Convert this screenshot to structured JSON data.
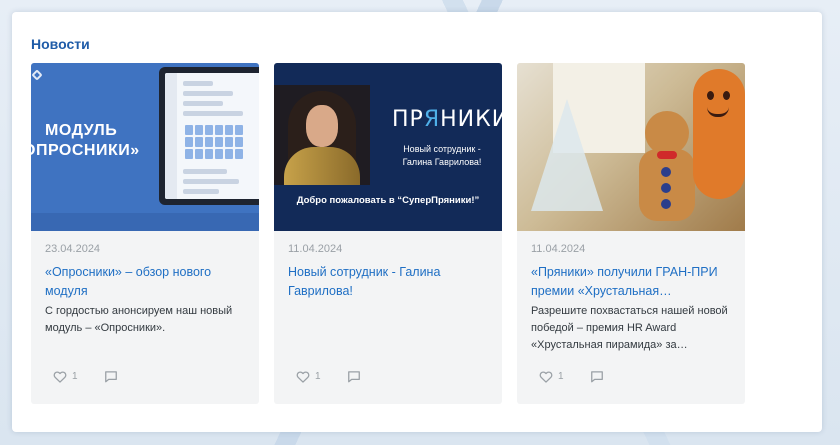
{
  "section": {
    "title": "Новости"
  },
  "cards": [
    {
      "date": "23.04.2024",
      "title": "«Опросники» – обзор нового модуля",
      "excerpt": "С гордостью анонсируем наш новый модуль – «Опросники».",
      "likes": "1",
      "image": {
        "line1": "МОДУЛЬ",
        "line2": "ОПРОСНИКИ»"
      }
    },
    {
      "date": "11.04.2024",
      "title": "Новый сотрудник - Галина Гаврилова!",
      "excerpt": "",
      "likes": "1",
      "image": {
        "brand_pre": "ПР",
        "brand_accent": "Я",
        "brand_post": "НИКИ",
        "subtitle": "Новый сотрудник - Галина Гаврилова!",
        "welcome": "Добро пожаловать в “СуперПряники!”"
      }
    },
    {
      "date": "11.04.2024",
      "title": "«Пряники» получили ГРАН-ПРИ премии «Хрустальная…",
      "excerpt": "Разрешите похвастаться нашей новой победой – премия HR Award «Хрустальная пирамида» за…",
      "likes": "1",
      "image": {}
    }
  ],
  "icons": {
    "like": "heart-outline-icon",
    "comment": "comment-icon"
  },
  "colors": {
    "accent": "#1f6fc4",
    "title": "#1f5ca8",
    "card_bg": "#f3f4f5",
    "muted": "#9aa0a6"
  }
}
